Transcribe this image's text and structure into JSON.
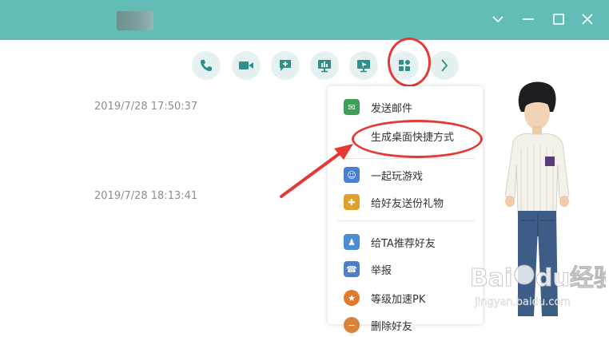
{
  "window": {
    "controls": [
      "chevron-down-icon",
      "minimize-icon",
      "maximize-icon",
      "close-icon"
    ]
  },
  "toolbar": {
    "buttons": [
      "phone-icon",
      "video-icon",
      "chat-add-icon",
      "screen-share-icon",
      "remote-assist-icon",
      "apps-icon",
      "chevron-right-icon"
    ]
  },
  "chat": {
    "timestamps": [
      "2019/7/28 17:50:37",
      "2019/7/28 18:13:41"
    ]
  },
  "menu": {
    "items": [
      {
        "label": "发送邮件",
        "icon": "mail-icon"
      },
      {
        "label": "生成桌面快捷方式",
        "icon": ""
      },
      {
        "label": "一起玩游戏",
        "icon": "game-icon"
      },
      {
        "label": "给好友送份礼物",
        "icon": "gift-icon"
      },
      {
        "label": "给TA推荐好友",
        "icon": "recommend-icon"
      },
      {
        "label": "举报",
        "icon": "report-icon"
      },
      {
        "label": "等级加速PK",
        "icon": "level-icon"
      },
      {
        "label": "删除好友",
        "icon": "delete-friend-icon"
      }
    ]
  },
  "watermark": {
    "brand": "Baidu经验",
    "url": "jingyan.baidu.com"
  },
  "colors": {
    "titlebar": "#63bdb7",
    "accent": "#2f8f89",
    "annotation": "#e53935"
  }
}
